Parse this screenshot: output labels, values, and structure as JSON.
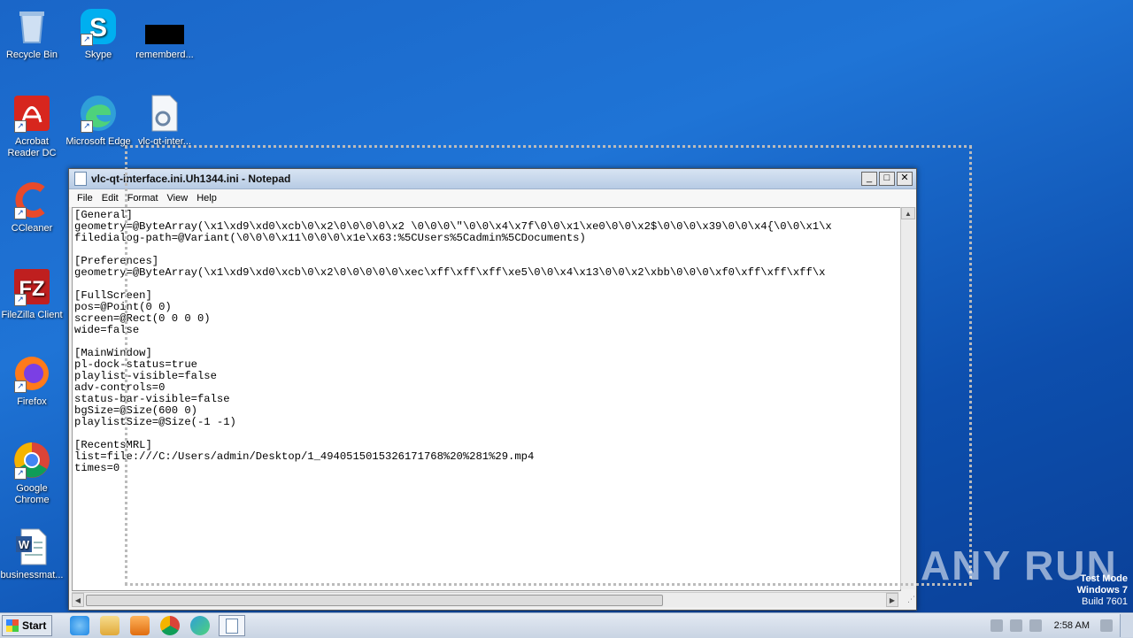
{
  "desktop": {
    "icons": [
      {
        "label": "Recycle Bin",
        "icon": "recycle-bin-icon",
        "color": "#7aa7d9"
      },
      {
        "label": "Skype",
        "icon": "skype-icon",
        "color": "#00aff0"
      },
      {
        "label": "rememberd...",
        "icon": "black-file-icon",
        "color": "#000000"
      },
      {
        "label": "Acrobat Reader DC",
        "icon": "acrobat-icon",
        "color": "#d7261e"
      },
      {
        "label": "Microsoft Edge",
        "icon": "edge-icon",
        "color": "#2f9fd8"
      },
      {
        "label": "vlc-qt-inter...",
        "icon": "config-file-icon",
        "color": "#dfe7ef"
      },
      {
        "label": "CCleaner",
        "icon": "ccleaner-icon",
        "color": "#e84a2b"
      },
      {
        "label": "FileZilla Client",
        "icon": "filezilla-icon",
        "color": "#bf1f1f"
      },
      {
        "label": "Firefox",
        "icon": "firefox-icon",
        "color": "#ff7a1a"
      },
      {
        "label": "Google Chrome",
        "icon": "chrome-icon",
        "color": "#4285f4"
      },
      {
        "label": "businessmat...",
        "icon": "word-doc-icon",
        "color": "#2b5797"
      }
    ]
  },
  "notepad": {
    "title": "vlc-qt-interface.ini.Uh1344.ini - Notepad",
    "menu": [
      "File",
      "Edit",
      "Format",
      "View",
      "Help"
    ],
    "content_lines": [
      "[General]",
      "geometry=@ByteArray(\\x1\\xd9\\xd0\\xcb\\0\\x2\\0\\0\\0\\0\\x2 \\0\\0\\0\\\"\\0\\0\\x4\\x7f\\0\\0\\x1\\xe0\\0\\0\\x2$\\0\\0\\0\\x39\\0\\0\\x4{\\0\\0\\x1\\x",
      "filedialog-path=@Variant(\\0\\0\\0\\x11\\0\\0\\0\\x1e\\x63:%5CUsers%5Cadmin%5CDocuments)",
      "",
      "[Preferences]",
      "geometry=@ByteArray(\\x1\\xd9\\xd0\\xcb\\0\\x2\\0\\0\\0\\0\\0\\xec\\xff\\xff\\xff\\xe5\\0\\0\\x4\\x13\\0\\0\\x2\\xbb\\0\\0\\0\\xf0\\xff\\xff\\xff\\x",
      "",
      "[FullScreen]",
      "pos=@Point(0 0)",
      "screen=@Rect(0 0 0 0)",
      "wide=false",
      "",
      "[MainWindow]",
      "pl-dock-status=true",
      "playlist-visible=false",
      "adv-controls=0",
      "status-bar-visible=false",
      "bgSize=@Size(600 0)",
      "playlistSize=@Size(-1 -1)",
      "",
      "[RecentsMRL]",
      "list=file:///C:/Users/admin/Desktop/1_4940515015326171768%20%281%29.mp4",
      "times=0"
    ]
  },
  "watermark": "ANY RUN",
  "testmode": {
    "line1": "Test Mode",
    "line2": "Windows 7",
    "line3": "Build 7601"
  },
  "taskbar": {
    "start_label": "Start",
    "clock": "2:58 AM",
    "apps": [
      {
        "icon": "ie-icon",
        "color": "#1e88e5"
      },
      {
        "icon": "explorer-icon",
        "color": "#f2c14e"
      },
      {
        "icon": "media-player-icon",
        "color": "#f08a24"
      },
      {
        "icon": "chrome-icon",
        "color": "#4285f4"
      },
      {
        "icon": "edge-icon",
        "color": "#2f9fd8"
      }
    ]
  }
}
